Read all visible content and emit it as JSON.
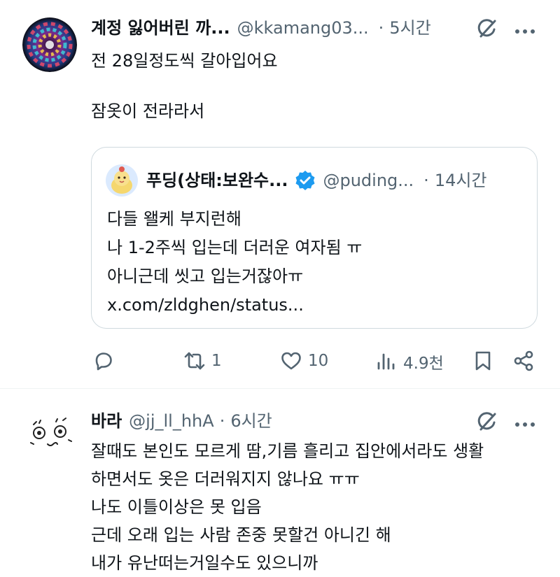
{
  "tweets": [
    {
      "display_name": "계정 잃어버린 까...",
      "handle": "@kkamang03...",
      "separator": "·",
      "time": "5시간",
      "lines": [
        "전 28일정도씩 갈아입어요",
        "",
        "잠옷이 전라라서"
      ],
      "quote": {
        "display_name": "푸딩(상태:보완수...",
        "handle": "@puding...",
        "separator": "·",
        "time": "14시간",
        "lines": [
          "다들 왤케 부지런해",
          "나 1-2주씩 입는데 더러운 여자됨 ㅠ",
          "아니근데 씻고 입는거잖아ㅠ",
          "x.com/zldghen/status..."
        ]
      },
      "actions": {
        "reply_count": "",
        "retweet_count": "1",
        "like_count": "10",
        "views_count": "4.9천"
      }
    },
    {
      "display_name": "바라",
      "handle": "@jj_ll_hhA",
      "separator": "·",
      "time": "6시간",
      "lines": [
        "잘때도 본인도 모르게 땀,기름 흘리고 집안에서라도 생활",
        "하면서도 옷은 더러워지지 않나요 ㅠㅠ",
        "나도 이틀이상은 못 입음",
        "근데 오래 입는 사람 존중 못할건 아니긴 해",
        "내가 유난떠는거일수도 있으니까"
      ]
    }
  ],
  "icons": {
    "reply": "reply-icon",
    "retweet": "retweet-icon",
    "like": "heart-icon",
    "views": "views-icon",
    "bookmark": "bookmark-icon",
    "share": "share-icon",
    "grok": "grok-icon",
    "more": "more-icon",
    "verified": "verified-badge-icon"
  },
  "colors": {
    "text": "#0f1419",
    "secondary": "#536471",
    "verified": "#1d9bf0",
    "border": "#cfd9de"
  }
}
